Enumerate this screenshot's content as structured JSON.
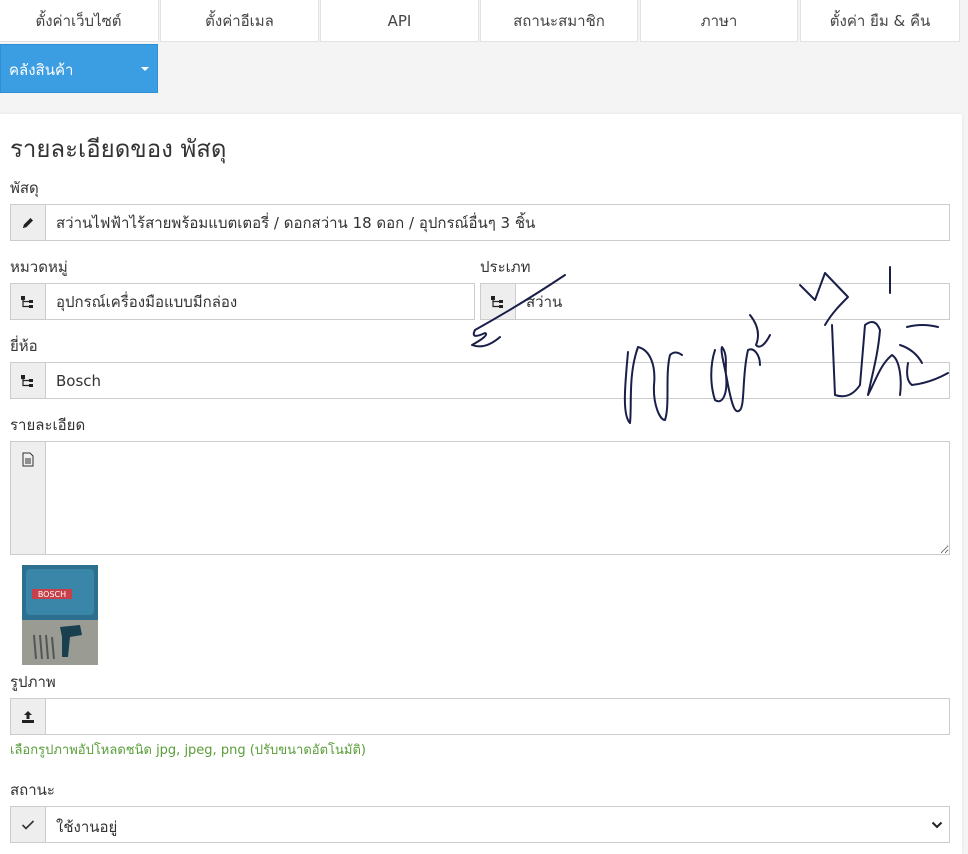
{
  "tabs": [
    "ตั้งค่าเว็บไซต์",
    "ตั้งค่าอีเมล",
    "API",
    "สถานะสมาชิก",
    "ภาษา",
    "ตั้งค่า ยืม & คืน"
  ],
  "dropdown": {
    "label": "คลังสินค้า",
    "icon": "caret-down-icon"
  },
  "page_title": "รายละเอียดของ พัสดุ",
  "form": {
    "item": {
      "label": "พัสดุ",
      "value": "สว่านไฟฟ้าไร้สายพร้อมแบตเตอรี่ / ดอกสว่าน 18 ดอก / อุปกรณ์อื่นๆ 3 ชิ้น",
      "icon": "pencil-icon"
    },
    "category": {
      "label": "หมวดหมู่",
      "value": "อุปกรณ์เครื่องมือแบบมีกล่อง",
      "icon": "tree-icon"
    },
    "type": {
      "label": "ประเภท",
      "value": "สว่าน",
      "icon": "tree-icon"
    },
    "brand": {
      "label": "ยี่ห้อ",
      "value": "Bosch",
      "icon": "tree-icon"
    },
    "detail": {
      "label": "รายละเอียด",
      "value": "",
      "icon": "document-icon"
    },
    "image": {
      "label": "รูปภาพ",
      "value": "",
      "icon": "upload-icon",
      "help": "เลือกรูปภาพอัปโหลดชนิด jpg, jpeg, png (ปรับขนาดอัตโนมัติ)",
      "thumbnail_brand": "BOSCH"
    },
    "status": {
      "label": "สถานะ",
      "value": "ใช้งานอยู่",
      "icon": "check-icon"
    }
  },
  "colors": {
    "accent": "#3b9de2",
    "help_text": "#5a9e3a",
    "addon_bg": "#eeeeee"
  }
}
